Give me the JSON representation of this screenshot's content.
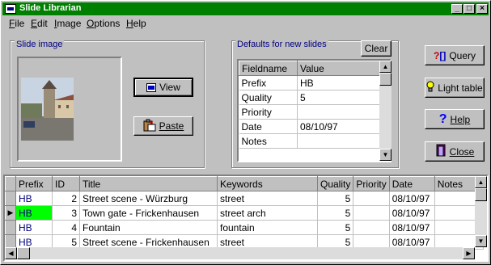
{
  "window": {
    "title": "Slide Librarian"
  },
  "menu": [
    {
      "label": "File",
      "u": "F",
      "rest": "ile"
    },
    {
      "label": "Edit",
      "u": "E",
      "rest": "dit"
    },
    {
      "label": "Image",
      "u": "I",
      "rest": "mage"
    },
    {
      "label": "Options",
      "u": "O",
      "rest": "ptions"
    },
    {
      "label": "Help",
      "u": "H",
      "rest": "elp"
    }
  ],
  "slide_image": {
    "label": "Slide image",
    "view_button": "View",
    "paste_button": "Paste"
  },
  "defaults": {
    "label": "Defaults for new slides",
    "clear_button": "Clear",
    "columns": [
      "Fieldname",
      "Value"
    ],
    "rows": [
      {
        "field": "Prefix",
        "value": "HB"
      },
      {
        "field": "Quality",
        "value": "5"
      },
      {
        "field": "Priority",
        "value": ""
      },
      {
        "field": "Date",
        "value": "08/10/97"
      },
      {
        "field": "Notes",
        "value": ""
      }
    ]
  },
  "side_buttons": {
    "query": "Query",
    "light_table": "Light table",
    "help": "Help",
    "close": "Close"
  },
  "slides": {
    "columns": [
      "Prefix",
      "ID",
      "Title",
      "Keywords",
      "Quality",
      "Priority",
      "Date",
      "Notes"
    ],
    "rows": [
      {
        "prefix": "HB",
        "id": "2",
        "title": "Street scene - Würzburg",
        "keywords": "street",
        "quality": "5",
        "priority": "",
        "date": "08/10/97",
        "notes": ""
      },
      {
        "prefix": "HB",
        "id": "3",
        "title": "Town gate - Frickenhausen",
        "keywords": "street arch",
        "quality": "5",
        "priority": "",
        "date": "08/10/97",
        "notes": ""
      },
      {
        "prefix": "HB",
        "id": "4",
        "title": "Fountain",
        "keywords": "fountain",
        "quality": "5",
        "priority": "",
        "date": "08/10/97",
        "notes": ""
      },
      {
        "prefix": "HB",
        "id": "5",
        "title": "Street scene - Frickenhausen",
        "keywords": "street",
        "quality": "5",
        "priority": "",
        "date": "08/10/97",
        "notes": ""
      }
    ],
    "current_row": 1
  },
  "colors": {
    "titlebar": "#008000",
    "selected_cell": "#00ff00",
    "label_blue": "#000080"
  }
}
